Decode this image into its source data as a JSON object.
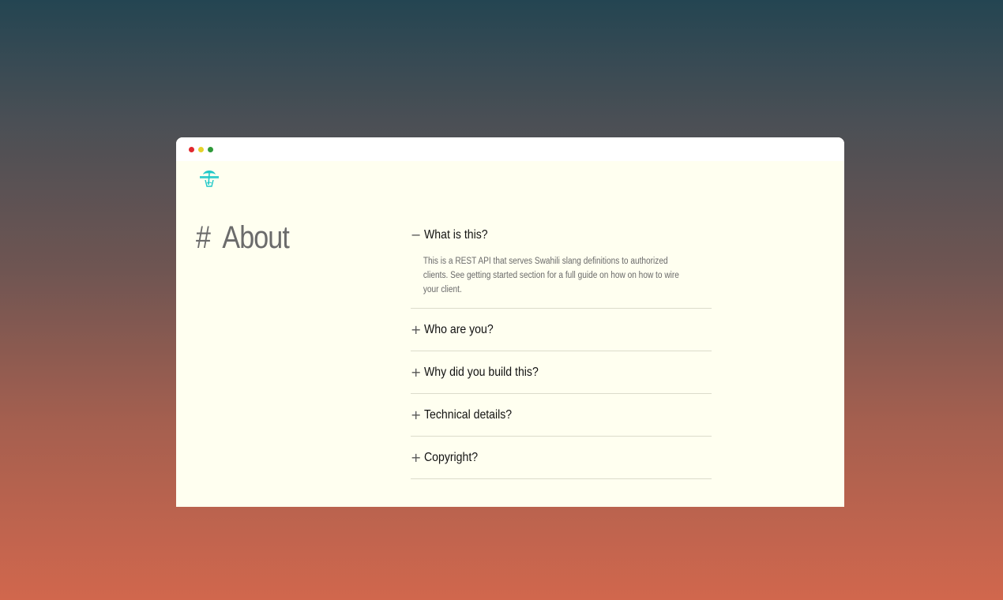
{
  "window": {
    "controls": [
      "close",
      "minimize",
      "maximize"
    ]
  },
  "logo": {
    "icon": "palm-tree-logo-icon",
    "color": "#1ec8c8"
  },
  "page": {
    "heading_hash": "#",
    "heading": "About"
  },
  "faq": [
    {
      "toggle": "−",
      "question": "What is this?",
      "answer": "This is a REST API that serves Swahili slang definitions to authorized clients. See getting started section for a full guide on how on how to wire your client.",
      "expanded": true
    },
    {
      "toggle": "+",
      "question": "Who are you?",
      "expanded": false
    },
    {
      "toggle": "+",
      "question": "Why did you build this?",
      "expanded": false
    },
    {
      "toggle": "+",
      "question": "Technical details?",
      "expanded": false
    },
    {
      "toggle": "+",
      "question": "Copyright?",
      "expanded": false
    }
  ]
}
